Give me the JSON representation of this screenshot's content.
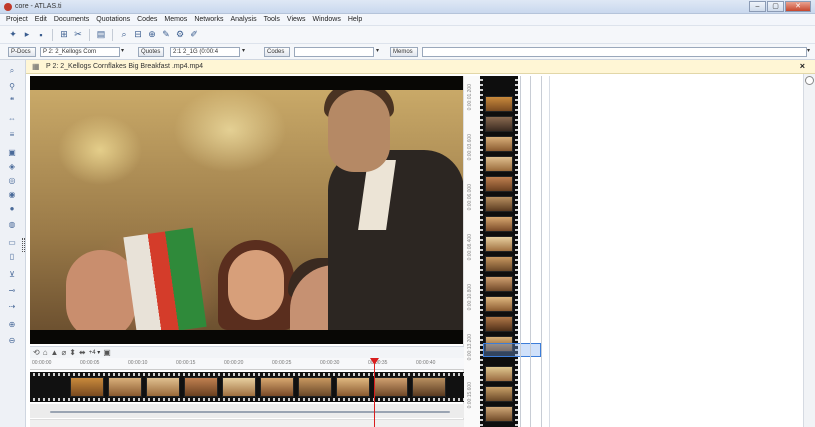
{
  "window": {
    "title": "core - ATLAS.ti",
    "controls": [
      "–",
      "▢",
      "✕"
    ]
  },
  "menu": [
    "Project",
    "Edit",
    "Documents",
    "Quotations",
    "Codes",
    "Memos",
    "Networks",
    "Analysis",
    "Tools",
    "Views",
    "Windows",
    "Help"
  ],
  "toolbar2": {
    "pdocs_label": "P-Docs",
    "document_select": "P 2: 2_Kellogs Corn",
    "quotes_label": "Quotes",
    "quotation_select": "2:1 2_1G (0:00:4",
    "codes_label": "Codes",
    "memos_label": "Memos"
  },
  "document": {
    "title": "P 2: 2_Kellogs Cornflakes Big Breakfast .mp4.mp4",
    "close": "×"
  },
  "media": {
    "controls": [
      "⟲",
      "⌂",
      "▲",
      "⌀",
      "⬍",
      "⬌"
    ],
    "zoom": "+4 ▾",
    "ruler_labels": [
      "00:00:00",
      "00:00:05",
      "00:00:10",
      "00:00:15",
      "00:00:20",
      "00:00:25",
      "00:00:30",
      "00:00:35",
      "00:00:40"
    ]
  },
  "filmstrip_timestamps": [
    "0:00:01.200",
    "0:00:03.600",
    "0:00:06.000",
    "0:00:08.400",
    "0:00:10.800",
    "0:00:13.200",
    "0:00:15.600"
  ],
  "colors": {
    "accent_blue": "#3c7dd9",
    "playhead_red": "#d81e1e",
    "doc_header_bg": "#fff6d5"
  }
}
